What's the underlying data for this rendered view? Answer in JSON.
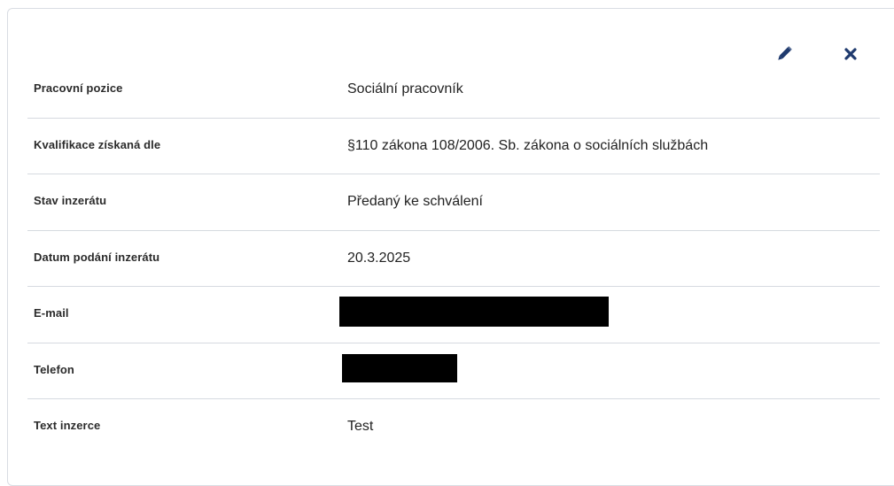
{
  "actions": {
    "edit_icon": "pencil-icon",
    "close_icon": "close-icon",
    "accent_color": "#1f3a6e"
  },
  "details": [
    {
      "label": "Pracovní pozice",
      "value": "Sociální pracovník"
    },
    {
      "label": "Kvalifikace získaná dle",
      "value": "§110 zákona 108/2006. Sb. zákona o sociálních službách"
    },
    {
      "label": "Stav inzerátu",
      "value": "Předaný ke schválení"
    },
    {
      "label": "Datum podání inzerátu",
      "value": "20.3.2025"
    },
    {
      "label": "E-mail",
      "value": ""
    },
    {
      "label": "Telefon",
      "value": ""
    },
    {
      "label": "Text inzerce",
      "value": "Test"
    }
  ]
}
